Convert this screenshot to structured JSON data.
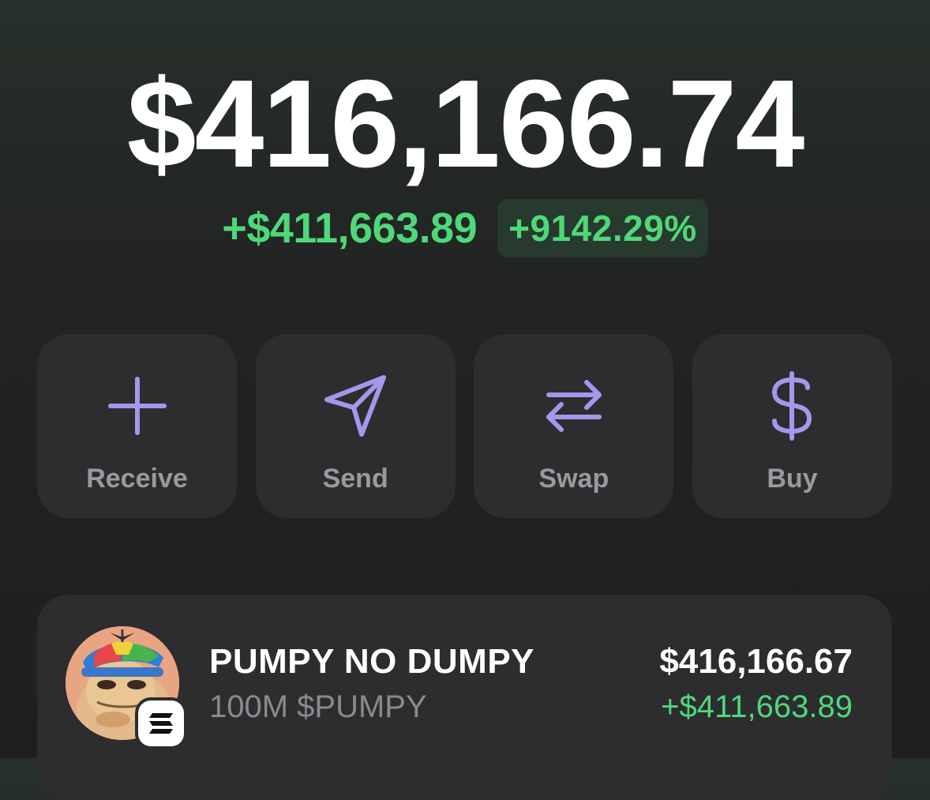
{
  "portfolio": {
    "balance": "$416,166.74",
    "change_amount": "+$411,663.89",
    "change_percent": "+9142.29%"
  },
  "actions": [
    {
      "label": "Receive",
      "icon": "plus-icon"
    },
    {
      "label": "Send",
      "icon": "send-icon"
    },
    {
      "label": "Swap",
      "icon": "swap-icon"
    },
    {
      "label": "Buy",
      "icon": "dollar-icon"
    }
  ],
  "token": {
    "name": "PUMPY NO DUMPY",
    "amount": "100M $PUMPY",
    "value": "$416,166.67",
    "change": "+$411,663.89",
    "avatar_icon": "pumpy-mascot-avatar",
    "chain_icon": "solana-chain-icon"
  },
  "colors": {
    "positive": "#4fd87a",
    "accent": "#a796ec",
    "card": "#2d2d2f"
  }
}
